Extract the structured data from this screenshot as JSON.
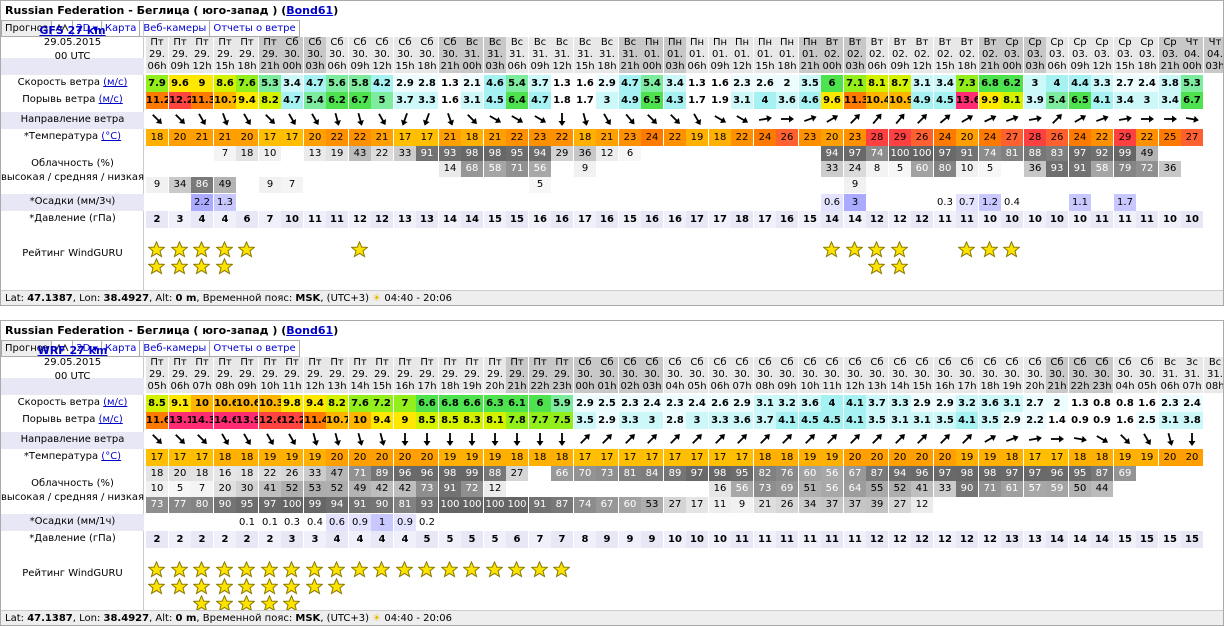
{
  "panels": [
    {
      "title": "Russian Federation - Беглица ( юго-запад )",
      "user": "Bond61",
      "tabs": [
        "Прогноз",
        "2D",
        "Карта",
        "Веб-камеры",
        "Отчеты о ветре"
      ],
      "model": "GFS 27 km",
      "run_date": "29.05.2015",
      "run_time": "00 UTC",
      "labels": {
        "speed": "Скорость ветра",
        "speed_unit": "(м/с)",
        "gust": "Порывь ветра",
        "gust_unit": "(м/с)",
        "dir": "Направление ветра",
        "temp": "*Температура",
        "temp_unit": "(°C)",
        "cloud1": "Облачность (%)",
        "cloud2": "высокая / средняя / низкая",
        "precip": "*Осадки (мм/3ч)",
        "pressure": "*Давление (гПа)",
        "rating": "Рейтинг WindGURU"
      },
      "footer": {
        "lat_label": "Lat:",
        "lat": "47.1387",
        "lon_label": "Lon:",
        "lon": "38.4927",
        "alt_label": "Alt:",
        "alt": "0 m",
        "tz_label": "Временной пояс:",
        "tz": "MSK",
        "tz_offset": "(UTC+3)",
        "sun": "04:40 - 20:06"
      },
      "days": [
        "Пт",
        "Пт",
        "Пт",
        "Пт",
        "Пт",
        "Пт",
        "Сб",
        "Сб",
        "Сб",
        "Сб",
        "Сб",
        "Сб",
        "Сб",
        "Сб",
        "Вс",
        "Вс",
        "Вс",
        "Вс",
        "Вс",
        "Вс",
        "Вс",
        "Вс",
        "Пн",
        "Пн",
        "Пн",
        "Пн",
        "Пн",
        "Пн",
        "Пн",
        "Пн",
        "Вт",
        "Вт",
        "Вт",
        "Вт",
        "Вт",
        "Вт",
        "Вт",
        "Вт",
        "Ср",
        "Ср",
        "Ср",
        "Ср",
        "Ср",
        "Ср",
        "Ср",
        "Ср",
        "Чт",
        "Чт",
        "Чт",
        "Чт",
        "Чт",
        "Чт",
        "Чт",
        "Чт",
        "Пт",
        "Пт",
        "Пт",
        "Пт",
        "Пт"
      ],
      "dates": [
        "29.",
        "29.",
        "29.",
        "29.",
        "29.",
        "29.",
        "30.",
        "30.",
        "30.",
        "30.",
        "30.",
        "30.",
        "30.",
        "30.",
        "31.",
        "31.",
        "31.",
        "31.",
        "31.",
        "31.",
        "31.",
        "31.",
        "01.",
        "01.",
        "01.",
        "01.",
        "01.",
        "01.",
        "01.",
        "01.",
        "02.",
        "02.",
        "02.",
        "02.",
        "02.",
        "02.",
        "02.",
        "02.",
        "03.",
        "03.",
        "03.",
        "03.",
        "03.",
        "03.",
        "03.",
        "03.",
        "04.",
        "04.",
        "04.",
        "04.",
        "04.",
        "04.",
        "04.",
        "04.",
        "05.",
        "05.",
        "05",
        "05",
        "05"
      ],
      "hours": [
        "06h",
        "09h",
        "12h",
        "15h",
        "18h",
        "21h",
        "00h",
        "03h",
        "06h",
        "09h",
        "12h",
        "15h",
        "18h",
        "21h",
        "00h",
        "03h",
        "06h",
        "09h",
        "12h",
        "15h",
        "18h",
        "21h",
        "00h",
        "03h",
        "06h",
        "09h",
        "12h",
        "15h",
        "18h",
        "21h",
        "00h",
        "03h",
        "06h",
        "09h",
        "12h",
        "15h",
        "18h",
        "21h",
        "00h",
        "03h",
        "06h",
        "09h",
        "12h",
        "15h",
        "18h",
        "21h",
        "00h",
        "03h",
        "06h",
        "09h",
        "12h",
        "15h",
        "18h",
        "21h",
        "00h",
        "03h",
        "06h",
        "09h",
        "12h"
      ],
      "speed": [
        "7.9",
        "9.6",
        "9",
        "8.6",
        "7.6",
        "5.3",
        "3.4",
        "4.7",
        "5.6",
        "5.8",
        "4.2",
        "2.9",
        "2.8",
        "1.3",
        "2.1",
        "4.6",
        "5.4",
        "3.7",
        "1.3",
        "1.6",
        "2.9",
        "4.7",
        "5.4",
        "3.4",
        "1.3",
        "1.6",
        "2.3",
        "2.6",
        "2",
        "3.5",
        "6",
        "7.1",
        "8.1",
        "8.7",
        "3.1",
        "3.4",
        "7.3",
        "6.8",
        "6.2",
        "3",
        "4",
        "4.4",
        "3.3",
        "2.7",
        "2.4",
        "3.8",
        "5.3"
      ],
      "gust": [
        "11.2",
        "12.2",
        "11.3",
        "10.7",
        "9.4",
        "8.2",
        "4.7",
        "5.4",
        "6.2",
        "6.7",
        "5",
        "3.7",
        "3.3",
        "1.6",
        "3.1",
        "4.5",
        "6.4",
        "4.7",
        "1.8",
        "1.7",
        "3",
        "4.9",
        "6.5",
        "4.3",
        "1.7",
        "1.9",
        "3.1",
        "4",
        "3.6",
        "4.6",
        "9.6",
        "11.3",
        "10.4",
        "10.9",
        "4.9",
        "4.5",
        "13.6",
        "9.9",
        "8.1",
        "3.9",
        "5.4",
        "6.5",
        "4.1",
        "3.4",
        "3",
        "3.4",
        "6.7"
      ],
      "dir_deg": [
        315,
        315,
        330,
        340,
        330,
        315,
        330,
        330,
        345,
        345,
        330,
        20,
        20,
        340,
        315,
        300,
        300,
        300,
        0,
        345,
        330,
        320,
        315,
        315,
        330,
        300,
        300,
        260,
        270,
        250,
        240,
        225,
        220,
        220,
        225,
        230,
        240,
        245,
        250,
        260,
        225,
        240,
        250,
        260,
        270,
        270,
        280
      ],
      "temp": [
        "18",
        "20",
        "21",
        "21",
        "20",
        "17",
        "17",
        "20",
        "22",
        "22",
        "21",
        "17",
        "17",
        "21",
        "18",
        "21",
        "22",
        "23",
        "22",
        "18",
        "21",
        "23",
        "24",
        "22",
        "19",
        "18",
        "22",
        "24",
        "26",
        "23",
        "20",
        "23",
        "28",
        "29",
        "26",
        "24",
        "20",
        "24",
        "27",
        "28",
        "26",
        "24",
        "22",
        "29",
        "22",
        "25",
        "27"
      ],
      "cloud_h": [
        "",
        "",
        "",
        "7",
        "18",
        "10",
        "",
        "13",
        "19",
        "43",
        "22",
        "33",
        "91",
        "93",
        "98",
        "98",
        "95",
        "94",
        "29",
        "36",
        "12",
        "6",
        "",
        "",
        "",
        "",
        "",
        "",
        "",
        "",
        "94",
        "97",
        "74",
        "100",
        "100",
        "97",
        "91",
        "74",
        "81",
        "88",
        "83",
        "97",
        "92",
        "99",
        "49"
      ],
      "cloud_m": [
        "",
        "",
        "",
        "",
        "",
        "",
        "",
        "",
        "",
        "",
        "",
        "",
        "",
        "14",
        "68",
        "58",
        "71",
        "56",
        "",
        "9",
        "",
        "",
        "",
        "",
        "",
        "",
        "",
        "",
        "",
        "",
        "33",
        "24",
        "8",
        "5",
        "60",
        "80",
        "10",
        "5",
        "",
        "36",
        "93",
        "91",
        "58",
        "79",
        "72",
        "36"
      ],
      "cloud_l": [
        "9",
        "34",
        "86",
        "49",
        "",
        "9",
        "7",
        "",
        "",
        "",
        "",
        "",
        "",
        "",
        "",
        "",
        "",
        "5",
        "",
        "",
        "",
        "",
        "",
        "",
        "",
        "",
        "",
        "",
        "",
        "",
        "",
        "9",
        "",
        "",
        "",
        "",
        "",
        "",
        "",
        "",
        "",
        "",
        "",
        "",
        ""
      ],
      "precip": [
        "",
        "",
        "2.2",
        "1.3",
        "",
        "",
        "",
        "",
        "",
        "",
        "",
        "",
        "",
        "",
        "",
        "",
        "",
        "",
        "",
        "",
        "",
        "",
        "",
        "",
        "",
        "",
        "",
        "",
        "",
        "",
        "0.6",
        "3",
        "",
        "",
        "",
        "0.3",
        "0.7",
        "1.2",
        "0.4",
        "",
        "",
        "1.1",
        "",
        "1.7",
        ""
      ],
      "pressure": [
        "2",
        "3",
        "4",
        "4",
        "6",
        "7",
        "10",
        "11",
        "11",
        "12",
        "12",
        "13",
        "13",
        "14",
        "14",
        "15",
        "15",
        "16",
        "16",
        "17",
        "16",
        "15",
        "16",
        "16",
        "17",
        "17",
        "18",
        "17",
        "16",
        "15",
        "14",
        "14",
        "12",
        "12",
        "12",
        "11",
        "11",
        "10",
        "10",
        "10",
        "10",
        "10",
        "11",
        "11",
        "11",
        "10",
        "10"
      ],
      "stars": [
        2,
        2,
        2,
        2,
        1,
        0,
        0,
        0,
        0,
        1,
        0,
        0,
        0,
        0,
        0,
        0,
        0,
        0,
        0,
        0,
        0,
        0,
        0,
        0,
        0,
        0,
        0,
        0,
        0,
        0,
        1,
        1,
        2,
        2,
        0,
        0,
        1,
        1,
        1,
        0,
        0,
        0,
        0,
        0,
        0,
        0,
        0
      ]
    },
    {
      "title": "Russian Federation - Беглица ( юго-запад )",
      "user": "Bond61",
      "tabs": [
        "Прогноз",
        "2D",
        "Карта",
        "Веб-камеры",
        "Отчеты о ветре"
      ],
      "model": "WRF 27 km",
      "run_date": "29.05.2015",
      "run_time": "00 UTC",
      "labels": {
        "speed": "Скорость ветра",
        "speed_unit": "(м/с)",
        "gust": "Порывь ветра",
        "gust_unit": "(м/с)",
        "dir": "Направление ветра",
        "temp": "*Температура",
        "temp_unit": "(°C)",
        "cloud1": "Облачность (%)",
        "cloud2": "высокая / средняя / низкая",
        "precip": "*Осадки (мм/1ч)",
        "pressure": "*Давление (гПа)",
        "rating": "Рейтинг WindGURU"
      },
      "footer": {
        "lat_label": "Lat:",
        "lat": "47.1387",
        "lon_label": "Lon:",
        "lon": "38.4927",
        "alt_label": "Alt:",
        "alt": "0 m",
        "tz_label": "Временной пояс:",
        "tz": "MSK",
        "tz_offset": "(UTC+3)",
        "sun": "04:40 - 20:06"
      },
      "days": [
        "Пт",
        "Пт",
        "Пт",
        "Пт",
        "Пт",
        "Пт",
        "Пт",
        "Пт",
        "Пт",
        "Пт",
        "Пт",
        "Пт",
        "Пт",
        "Пт",
        "Пт",
        "Пт",
        "Пт",
        "Пт",
        "Пт",
        "Сб",
        "Сб",
        "Сб",
        "Сб",
        "Сб",
        "Сб",
        "Сб",
        "Сб",
        "Сб",
        "Сб",
        "Сб",
        "Сб",
        "Сб",
        "Сб",
        "Сб",
        "Сб",
        "Сб",
        "Сб",
        "Сб",
        "Сб",
        "Сб",
        "Сб",
        "Сб",
        "Сб",
        "Сб",
        "Сб",
        "Вс",
        "Зс",
        "Вс",
        "Вс",
        "Вс",
        "Вс",
        "Вс",
        "Вс"
      ],
      "dates": [
        "29.",
        "29.",
        "29.",
        "29.",
        "29.",
        "29.",
        "29.",
        "29.",
        "29.",
        "29.",
        "29.",
        "29.",
        "29.",
        "29.",
        "29.",
        "29.",
        "29.",
        "29.",
        "29.",
        "30.",
        "30.",
        "30.",
        "30.",
        "30.",
        "30.",
        "30.",
        "30.",
        "30.",
        "30.",
        "30.",
        "30.",
        "30.",
        "30.",
        "30.",
        "30.",
        "30.",
        "30.",
        "30.",
        "30.",
        "30.",
        "30.",
        "30.",
        "30.",
        "30.",
        "30.",
        "31.",
        "31.",
        "31.",
        "31.",
        "31.",
        "31.",
        "31.",
        "31."
      ],
      "hours": [
        "05h",
        "06h",
        "07h",
        "08h",
        "09h",
        "10h",
        "11h",
        "12h",
        "13h",
        "14h",
        "15h",
        "16h",
        "17h",
        "18h",
        "19h",
        "20h",
        "21h",
        "22h",
        "23h",
        "00h",
        "01h",
        "02h",
        "03h",
        "04h",
        "05h",
        "06h",
        "07h",
        "08h",
        "09h",
        "10h",
        "11h",
        "12h",
        "13h",
        "14h",
        "15h",
        "16h",
        "17h",
        "18h",
        "19h",
        "20h",
        "21h",
        "22h",
        "23h",
        "04h",
        "05h",
        "06h",
        "07h",
        "08h",
        "09h",
        "10h",
        "11h",
        "12h",
        "13h"
      ],
      "speed": [
        "8.5",
        "9.1",
        "10",
        "10.6",
        "10.6",
        "10.3",
        "9.8",
        "9.4",
        "8.2",
        "7.6",
        "7.2",
        "7",
        "6.6",
        "6.8",
        "6.6",
        "6.3",
        "6.1",
        "6",
        "5.9",
        "2.9",
        "2.5",
        "2.3",
        "2.4",
        "2.3",
        "2.4",
        "2.6",
        "2.9",
        "3.1",
        "3.2",
        "3.6",
        "4",
        "4.1",
        "3.7",
        "3.3",
        "2.9",
        "2.9",
        "3.2",
        "3.6",
        "3.1",
        "2.7",
        "2",
        "1.3",
        "0.8",
        "0.8",
        "1.6",
        "2.3",
        "2.4"
      ],
      "gust": [
        "11.6",
        "13.1",
        "14.3",
        "14.6",
        "13.9",
        "12.6",
        "12.2",
        "11.4",
        "10.7",
        "10",
        "9.4",
        "9",
        "8.5",
        "8.5",
        "8.3",
        "8.1",
        "7.8",
        "7.7",
        "7.5",
        "3.5",
        "2.9",
        "3.3",
        "3",
        "2.8",
        "3",
        "3.3",
        "3.6",
        "3.7",
        "4.1",
        "4.5",
        "4.5",
        "4.1",
        "3.5",
        "3.1",
        "3.1",
        "3.5",
        "4.1",
        "3.5",
        "2.9",
        "2.2",
        "1.4",
        "0.9",
        "0.9",
        "1.6",
        "2.5",
        "3.1",
        "3.8"
      ],
      "dir_deg": [
        315,
        315,
        315,
        330,
        330,
        330,
        330,
        345,
        345,
        345,
        345,
        0,
        0,
        0,
        0,
        0,
        0,
        0,
        0,
        225,
        225,
        225,
        225,
        225,
        225,
        225,
        225,
        225,
        225,
        225,
        225,
        225,
        225,
        225,
        225,
        225,
        225,
        240,
        250,
        260,
        270,
        280,
        300,
        315,
        330,
        345,
        0
      ],
      "temp": [
        "17",
        "17",
        "17",
        "18",
        "18",
        "19",
        "19",
        "19",
        "20",
        "20",
        "20",
        "20",
        "20",
        "19",
        "19",
        "19",
        "18",
        "18",
        "18",
        "17",
        "17",
        "17",
        "17",
        "17",
        "17",
        "17",
        "17",
        "18",
        "18",
        "19",
        "19",
        "20",
        "20",
        "20",
        "20",
        "20",
        "19",
        "19",
        "18",
        "17",
        "17",
        "18",
        "18",
        "19",
        "19",
        "20",
        "20"
      ],
      "cloud_h": [
        "18",
        "20",
        "18",
        "16",
        "18",
        "22",
        "26",
        "33",
        "47",
        "71",
        "89",
        "96",
        "96",
        "98",
        "99",
        "88",
        "27",
        "",
        "66",
        "70",
        "73",
        "81",
        "84",
        "89",
        "97",
        "98",
        "95",
        "82",
        "76",
        "60",
        "56",
        "67",
        "87",
        "94",
        "96",
        "97",
        "98",
        "98",
        "97",
        "97",
        "96",
        "95",
        "87",
        "69"
      ],
      "cloud_m": [
        "10",
        "5",
        "7",
        "20",
        "30",
        "41",
        "52",
        "53",
        "52",
        "49",
        "42",
        "42",
        "73",
        "91",
        "72",
        "12",
        "",
        "",
        "",
        "",
        "",
        "",
        "",
        "",
        "",
        "16",
        "56",
        "73",
        "69",
        "51",
        "56",
        "64",
        "55",
        "52",
        "41",
        "33",
        "90",
        "71",
        "61",
        "57",
        "59",
        "50",
        "44"
      ],
      "cloud_l": [
        "73",
        "77",
        "80",
        "90",
        "95",
        "97",
        "100",
        "99",
        "94",
        "91",
        "90",
        "81",
        "93",
        "100",
        "100",
        "100",
        "100",
        "91",
        "87",
        "74",
        "67",
        "60",
        "53",
        "27",
        "17",
        "11",
        "9",
        "21",
        "26",
        "34",
        "37",
        "37",
        "39",
        "27",
        "12"
      ],
      "precip": [
        "",
        "",
        "",
        "",
        "0.1",
        "0.1",
        "0.3",
        "0.4",
        "0.6",
        "0.9",
        "1",
        "0.9",
        "0.2",
        "",
        "",
        "",
        "",
        "",
        "",
        "",
        "",
        "",
        "",
        "",
        "",
        "",
        "",
        "",
        "",
        "",
        "",
        "",
        "",
        "",
        "",
        "",
        "",
        "",
        "",
        "",
        "",
        "",
        "",
        "",
        "",
        "",
        ""
      ],
      "pressure": [
        "2",
        "2",
        "2",
        "2",
        "2",
        "2",
        "3",
        "3",
        "4",
        "4",
        "4",
        "4",
        "5",
        "5",
        "5",
        "5",
        "6",
        "7",
        "7",
        "8",
        "9",
        "9",
        "9",
        "10",
        "10",
        "10",
        "11",
        "11",
        "11",
        "11",
        "11",
        "11",
        "12",
        "12",
        "12",
        "12",
        "12",
        "12",
        "13",
        "13",
        "14",
        "14",
        "14",
        "15",
        "15",
        "15",
        "15"
      ],
      "stars": [
        2,
        2,
        3,
        3,
        3,
        3,
        3,
        2,
        2,
        1,
        1,
        1,
        1,
        1,
        1,
        1,
        1,
        1,
        1,
        0,
        0,
        0,
        0,
        0,
        0,
        0,
        0,
        0,
        0,
        0,
        0,
        0,
        0,
        0,
        0,
        0,
        0,
        0,
        0,
        0,
        0,
        0,
        0,
        0,
        0,
        0,
        0
      ]
    }
  ]
}
